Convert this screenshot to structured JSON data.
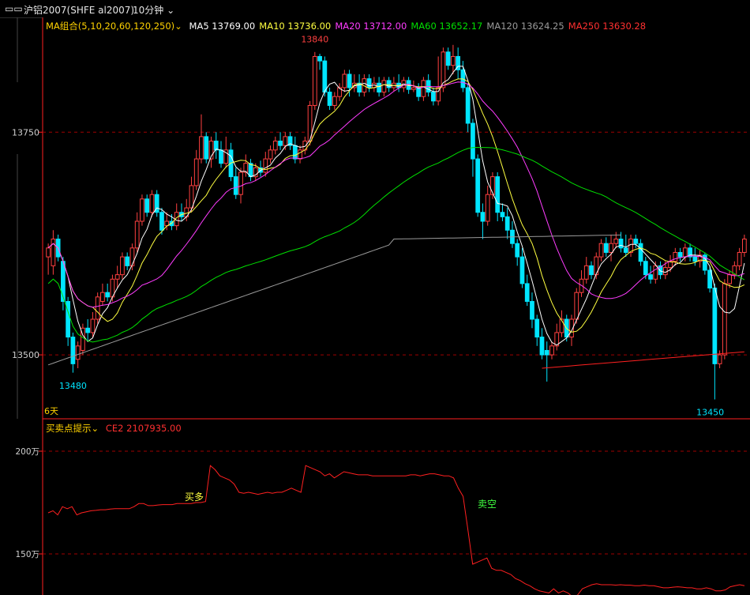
{
  "titlebar": {
    "symbol": "沪铝2007(SHFE al2007)",
    "period": "10分钟"
  },
  "ma_legend": {
    "combo": "MA组合(5,10,20,60,120,250)",
    "ma5": "MA5 13769.00",
    "ma10": "MA10 13736.00",
    "ma20": "MA20 13712.00",
    "ma60": "MA60 13652.17",
    "ma120": "MA120 13624.25",
    "ma250": "MA250 13630.28"
  },
  "price_axis": {
    "ticks": [
      "13750",
      "13500"
    ]
  },
  "annotations": {
    "high": "13840",
    "low_left": "13480",
    "low_right": "13450",
    "range": "6天"
  },
  "indicator": {
    "title": "买卖点提示",
    "ce2": "CE2 2107935.00",
    "ticks": [
      "200万",
      "150万"
    ],
    "buy_label": "买多",
    "sell_label": "卖空"
  },
  "colors": {
    "up": "#ff4040",
    "down": "#00e5ff",
    "ma5": "#ffffff",
    "ma10": "#ffff40",
    "ma20": "#ff3cff",
    "ma60": "#00e000",
    "ma120": "#9a9a9a",
    "ma250": "#ff2020",
    "ce2": "#ff2020",
    "grid": "#a00000",
    "frame": "#ff2020"
  },
  "chart_data": {
    "type": "candlestick",
    "ylim": [
      13430,
      13870
    ],
    "ce2_ylim": [
      1300000,
      2100000
    ],
    "candles": [
      [
        13610,
        13620,
        13590,
        13625
      ],
      [
        13600,
        13630,
        13590,
        13640
      ],
      [
        13630,
        13610,
        13605,
        13635
      ],
      [
        13605,
        13560,
        13550,
        13610
      ],
      [
        13560,
        13520,
        13510,
        13565
      ],
      [
        13520,
        13490,
        13480,
        13525
      ],
      [
        13495,
        13510,
        13485,
        13515
      ],
      [
        13505,
        13530,
        13500,
        13535
      ],
      [
        13530,
        13525,
        13515,
        13540
      ],
      [
        13525,
        13540,
        13520,
        13548
      ],
      [
        13540,
        13565,
        13535,
        13570
      ],
      [
        13560,
        13570,
        13555,
        13580
      ],
      [
        13570,
        13565,
        13560,
        13580
      ],
      [
        13565,
        13585,
        13560,
        13590
      ],
      [
        13585,
        13590,
        13575,
        13600
      ],
      [
        13590,
        13610,
        13585,
        13615
      ],
      [
        13610,
        13600,
        13595,
        13615
      ],
      [
        13600,
        13620,
        13595,
        13625
      ],
      [
        13620,
        13650,
        13615,
        13660
      ],
      [
        13650,
        13675,
        13645,
        13680
      ],
      [
        13675,
        13660,
        13655,
        13680
      ],
      [
        13660,
        13680,
        13655,
        13685
      ],
      [
        13680,
        13660,
        13655,
        13685
      ],
      [
        13660,
        13640,
        13635,
        13665
      ],
      [
        13645,
        13650,
        13640,
        13660
      ],
      [
        13650,
        13645,
        13640,
        13658
      ],
      [
        13645,
        13660,
        13640,
        13670
      ],
      [
        13660,
        13655,
        13650,
        13670
      ],
      [
        13655,
        13665,
        13650,
        13675
      ],
      [
        13665,
        13690,
        13660,
        13700
      ],
      [
        13690,
        13720,
        13685,
        13730
      ],
      [
        13720,
        13745,
        13715,
        13770
      ],
      [
        13745,
        13720,
        13715,
        13750
      ],
      [
        13720,
        13740,
        13710,
        13745
      ],
      [
        13740,
        13730,
        13720,
        13750
      ],
      [
        13730,
        13715,
        13710,
        13740
      ],
      [
        13715,
        13730,
        13710,
        13745
      ],
      [
        13730,
        13700,
        13695,
        13738
      ],
      [
        13700,
        13680,
        13675,
        13710
      ],
      [
        13680,
        13705,
        13670,
        13710
      ],
      [
        13705,
        13715,
        13700,
        13725
      ],
      [
        13715,
        13700,
        13695,
        13720
      ],
      [
        13700,
        13710,
        13695,
        13715
      ],
      [
        13710,
        13705,
        13700,
        13718
      ],
      [
        13705,
        13720,
        13700,
        13728
      ],
      [
        13720,
        13730,
        13715,
        13735
      ],
      [
        13730,
        13740,
        13725,
        13745
      ],
      [
        13740,
        13735,
        13730,
        13750
      ],
      [
        13735,
        13745,
        13730,
        13750
      ],
      [
        13745,
        13735,
        13730,
        13750
      ],
      [
        13735,
        13720,
        13715,
        13745
      ],
      [
        13720,
        13730,
        13715,
        13735
      ],
      [
        13730,
        13740,
        13725,
        13745
      ],
      [
        13740,
        13780,
        13735,
        13785
      ],
      [
        13780,
        13835,
        13775,
        13840
      ],
      [
        13835,
        13830,
        13820,
        13838
      ],
      [
        13830,
        13795,
        13790,
        13835
      ],
      [
        13795,
        13780,
        13775,
        13800
      ],
      [
        13780,
        13790,
        13775,
        13795
      ],
      [
        13790,
        13800,
        13785,
        13805
      ],
      [
        13800,
        13815,
        13795,
        13820
      ],
      [
        13815,
        13800,
        13790,
        13820
      ],
      [
        13800,
        13805,
        13795,
        13815
      ],
      [
        13805,
        13795,
        13790,
        13815
      ],
      [
        13795,
        13810,
        13790,
        13815
      ],
      [
        13810,
        13800,
        13795,
        13815
      ],
      [
        13800,
        13805,
        13795,
        13812
      ],
      [
        13805,
        13795,
        13790,
        13812
      ],
      [
        13795,
        13808,
        13790,
        13812
      ],
      [
        13808,
        13800,
        13795,
        13812
      ],
      [
        13800,
        13805,
        13796,
        13812
      ],
      [
        13805,
        13800,
        13795,
        13815
      ],
      [
        13800,
        13808,
        13795,
        13812
      ],
      [
        13808,
        13798,
        13793,
        13812
      ],
      [
        13798,
        13800,
        13795,
        13808
      ],
      [
        13800,
        13790,
        13785,
        13805
      ],
      [
        13790,
        13808,
        13785,
        13812
      ],
      [
        13808,
        13795,
        13790,
        13815
      ],
      [
        13795,
        13785,
        13780,
        13800
      ],
      [
        13785,
        13800,
        13780,
        13835
      ],
      [
        13800,
        13840,
        13795,
        13845
      ],
      [
        13840,
        13825,
        13820,
        13845
      ],
      [
        13825,
        13835,
        13815,
        13848
      ],
      [
        13835,
        13820,
        13810,
        13845
      ],
      [
        13820,
        13800,
        13795,
        13830
      ],
      [
        13800,
        13760,
        13750,
        13805
      ],
      [
        13760,
        13720,
        13700,
        13765
      ],
      [
        13720,
        13660,
        13655,
        13725
      ],
      [
        13660,
        13650,
        13630,
        13670
      ],
      [
        13650,
        13680,
        13645,
        13690
      ],
      [
        13680,
        13700,
        13675,
        13705
      ],
      [
        13700,
        13660,
        13650,
        13705
      ],
      [
        13660,
        13655,
        13650,
        13670
      ],
      [
        13655,
        13640,
        13630,
        13665
      ],
      [
        13640,
        13625,
        13620,
        13650
      ],
      [
        13625,
        13610,
        13600,
        13630
      ],
      [
        13610,
        13580,
        13575,
        13620
      ],
      [
        13580,
        13560,
        13555,
        13590
      ],
      [
        13560,
        13540,
        13530,
        13570
      ],
      [
        13540,
        13520,
        13510,
        13545
      ],
      [
        13520,
        13500,
        13495,
        13530
      ],
      [
        13505,
        13500,
        13470,
        13515
      ],
      [
        13500,
        13510,
        13495,
        13515
      ],
      [
        13510,
        13525,
        13505,
        13535
      ],
      [
        13525,
        13540,
        13520,
        13550
      ],
      [
        13540,
        13520,
        13515,
        13545
      ],
      [
        13520,
        13540,
        13510,
        13545
      ],
      [
        13540,
        13570,
        13535,
        13575
      ],
      [
        13570,
        13585,
        13565,
        13595
      ],
      [
        13585,
        13600,
        13580,
        13610
      ],
      [
        13600,
        13590,
        13585,
        13605
      ],
      [
        13590,
        13610,
        13585,
        13615
      ],
      [
        13610,
        13625,
        13605,
        13630
      ],
      [
        13625,
        13615,
        13610,
        13632
      ],
      [
        13615,
        13625,
        13605,
        13635
      ],
      [
        13625,
        13630,
        13620,
        13638
      ],
      [
        13630,
        13620,
        13615,
        13638
      ],
      [
        13620,
        13615,
        13610,
        13635
      ],
      [
        13615,
        13630,
        13610,
        13635
      ],
      [
        13630,
        13625,
        13620,
        13635
      ],
      [
        13625,
        13605,
        13600,
        13630
      ],
      [
        13605,
        13590,
        13585,
        13610
      ],
      [
        13590,
        13585,
        13580,
        13600
      ],
      [
        13585,
        13600,
        13580,
        13605
      ],
      [
        13600,
        13590,
        13585,
        13605
      ],
      [
        13590,
        13598,
        13585,
        13605
      ],
      [
        13598,
        13605,
        13593,
        13612
      ],
      [
        13605,
        13615,
        13600,
        13620
      ],
      [
        13615,
        13610,
        13605,
        13620
      ],
      [
        13610,
        13620,
        13605,
        13625
      ],
      [
        13620,
        13610,
        13605,
        13625
      ],
      [
        13610,
        13605,
        13600,
        13620
      ],
      [
        13605,
        13612,
        13598,
        13618
      ],
      [
        13612,
        13595,
        13590,
        13615
      ],
      [
        13595,
        13575,
        13570,
        13600
      ],
      [
        13575,
        13490,
        13450,
        13580
      ],
      [
        13490,
        13500,
        13485,
        13505
      ],
      [
        13500,
        13580,
        13495,
        13585
      ],
      [
        13580,
        13590,
        13575,
        13595
      ],
      [
        13590,
        13600,
        13585,
        13605
      ],
      [
        13600,
        13615,
        13595,
        13620
      ],
      [
        13615,
        13630,
        13610,
        13635
      ]
    ],
    "ce2": [
      1700000,
      1710000,
      1690000,
      1730000,
      1720000,
      1730000,
      1690000,
      1700000,
      1705000,
      1710000,
      1712000,
      1715000,
      1715000,
      1718000,
      1720000,
      1720000,
      1720000,
      1720000,
      1730000,
      1745000,
      1745000,
      1735000,
      1735000,
      1738000,
      1740000,
      1740000,
      1740000,
      1745000,
      1745000,
      1745000,
      1745000,
      1750000,
      1750000,
      1755000,
      1930000,
      1910000,
      1880000,
      1870000,
      1860000,
      1840000,
      1800000,
      1795000,
      1800000,
      1795000,
      1790000,
      1795000,
      1800000,
      1795000,
      1800000,
      1800000,
      1810000,
      1820000,
      1810000,
      1800000,
      1930000,
      1920000,
      1910000,
      1900000,
      1880000,
      1890000,
      1870000,
      1885000,
      1900000,
      1895000,
      1890000,
      1885000,
      1885000,
      1885000,
      1880000,
      1880000,
      1880000,
      1880000,
      1880000,
      1880000,
      1880000,
      1880000,
      1885000,
      1885000,
      1880000,
      1885000,
      1890000,
      1890000,
      1885000,
      1880000,
      1880000,
      1870000,
      1820000,
      1780000,
      1620000,
      1450000,
      1460000,
      1470000,
      1480000,
      1430000,
      1420000,
      1420000,
      1410000,
      1400000,
      1380000,
      1370000,
      1355000,
      1345000,
      1330000,
      1320000,
      1315000,
      1310000,
      1330000,
      1310000,
      1320000,
      1310000,
      1290000,
      1300000,
      1330000,
      1340000,
      1350000,
      1355000,
      1350000,
      1350000,
      1350000,
      1348000,
      1350000,
      1348000,
      1348000,
      1345000,
      1345000,
      1348000,
      1345000,
      1345000,
      1340000,
      1335000,
      1335000,
      1338000,
      1340000,
      1338000,
      1335000,
      1335000,
      1330000,
      1330000,
      1335000,
      1330000,
      1320000,
      1320000,
      1325000,
      1340000,
      1345000,
      1350000,
      1345000
    ]
  }
}
